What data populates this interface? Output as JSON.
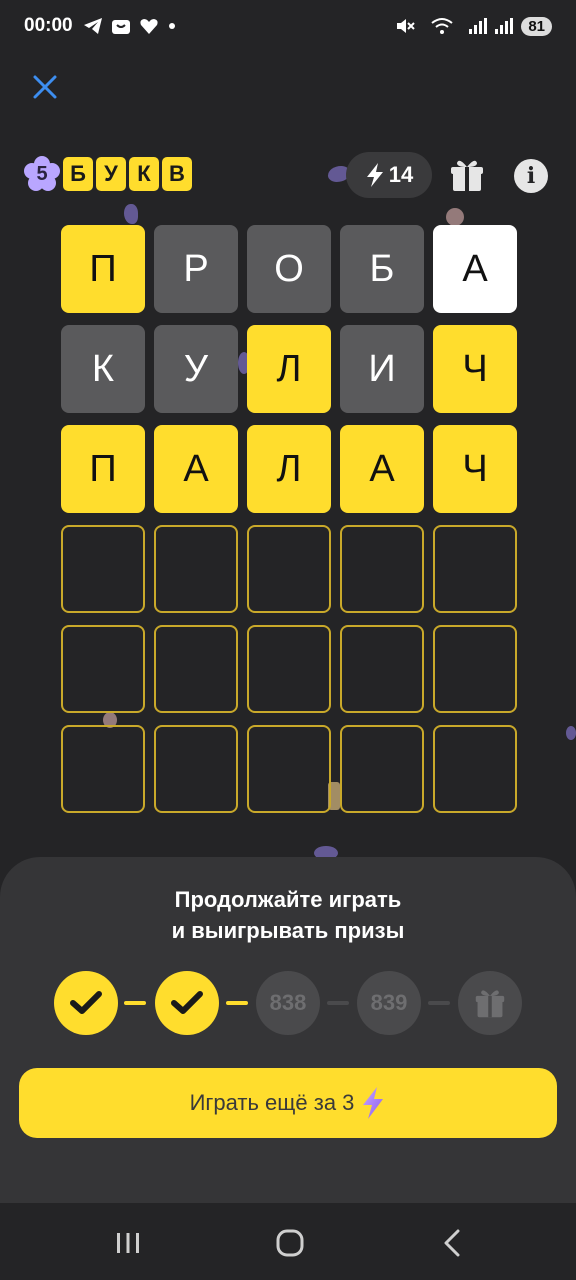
{
  "status_bar": {
    "time": "00:00",
    "battery": "81"
  },
  "header": {
    "logo_number": "5",
    "logo_letters": [
      "Б",
      "У",
      "К",
      "В"
    ],
    "energy_count": "14"
  },
  "board": {
    "rows": [
      [
        {
          "letter": "П",
          "state": "yellow"
        },
        {
          "letter": "Р",
          "state": "gray"
        },
        {
          "letter": "О",
          "state": "gray"
        },
        {
          "letter": "Б",
          "state": "gray"
        },
        {
          "letter": "А",
          "state": "white"
        }
      ],
      [
        {
          "letter": "К",
          "state": "gray"
        },
        {
          "letter": "У",
          "state": "gray"
        },
        {
          "letter": "Л",
          "state": "yellow"
        },
        {
          "letter": "И",
          "state": "gray"
        },
        {
          "letter": "Ч",
          "state": "yellow"
        }
      ],
      [
        {
          "letter": "П",
          "state": "yellow"
        },
        {
          "letter": "А",
          "state": "yellow"
        },
        {
          "letter": "Л",
          "state": "yellow"
        },
        {
          "letter": "А",
          "state": "yellow"
        },
        {
          "letter": "Ч",
          "state": "yellow"
        }
      ],
      [
        {
          "letter": "",
          "state": "empty"
        },
        {
          "letter": "",
          "state": "empty"
        },
        {
          "letter": "",
          "state": "empty"
        },
        {
          "letter": "",
          "state": "empty"
        },
        {
          "letter": "",
          "state": "empty"
        }
      ],
      [
        {
          "letter": "",
          "state": "empty"
        },
        {
          "letter": "",
          "state": "empty"
        },
        {
          "letter": "",
          "state": "empty"
        },
        {
          "letter": "",
          "state": "empty"
        },
        {
          "letter": "",
          "state": "empty"
        }
      ],
      [
        {
          "letter": "",
          "state": "empty"
        },
        {
          "letter": "",
          "state": "empty"
        },
        {
          "letter": "",
          "state": "empty"
        },
        {
          "letter": "",
          "state": "empty"
        },
        {
          "letter": "",
          "state": "empty"
        }
      ]
    ]
  },
  "sheet": {
    "title_line1": "Продолжайте играть",
    "title_line2": "и выигрывать призы",
    "steps": [
      {
        "type": "done",
        "label": ""
      },
      {
        "type": "done",
        "label": ""
      },
      {
        "type": "number",
        "label": "838"
      },
      {
        "type": "number",
        "label": "839"
      },
      {
        "type": "gift",
        "label": ""
      }
    ],
    "play_button_label": "Играть ещё за 3"
  },
  "colors": {
    "background": "#242426",
    "accent_yellow": "#ffdd2d",
    "tile_gray": "#5a5a5c",
    "sheet": "#353537"
  },
  "icons": {
    "close": "close-icon",
    "energy": "lightning-icon",
    "gift": "gift-icon",
    "info": "info-icon",
    "check": "check-icon",
    "nav_recent": "recent-apps-icon",
    "nav_home": "home-icon",
    "nav_back": "back-icon"
  }
}
